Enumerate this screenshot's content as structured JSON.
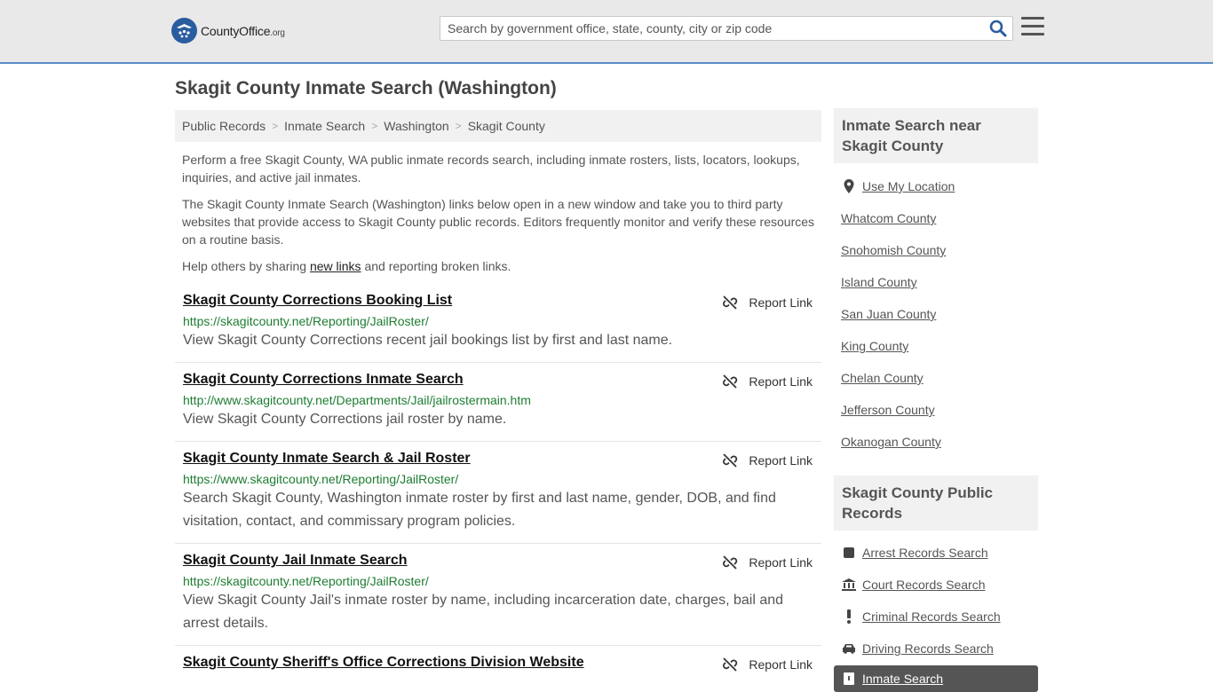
{
  "header": {
    "logo_county": "County",
    "logo_office": "Office",
    "logo_org": ".org",
    "search_placeholder": "Search by government office, state, county, city or zip code"
  },
  "page_title": "Skagit County Inmate Search (Washington)",
  "breadcrumb": [
    "Public Records",
    "Inmate Search",
    "Washington",
    "Skagit County"
  ],
  "intro": {
    "p1": "Perform a free Skagit County, WA public inmate records search, including inmate rosters, lists, locators, lookups, inquiries, and active jail inmates.",
    "p2": "The Skagit County Inmate Search (Washington) links below open in a new window and take you to third party websites that provide access to Skagit County public records. Editors frequently monitor and verify these resources on a routine basis.",
    "p3_before": "Help others by sharing ",
    "p3_link": "new links",
    "p3_after": " and reporting broken links."
  },
  "report_label": "Report Link",
  "results": [
    {
      "title": "Skagit County Corrections Booking List",
      "url": "https://skagitcounty.net/Reporting/JailRoster/",
      "desc": "View Skagit County Corrections recent jail bookings list by first and last name."
    },
    {
      "title": "Skagit County Corrections Inmate Search",
      "url": "http://www.skagitcounty.net/Departments/Jail/jailrostermain.htm",
      "desc": "View Skagit County Corrections jail roster by name."
    },
    {
      "title": "Skagit County Inmate Search & Jail Roster",
      "url": "https://www.skagitcounty.net/Reporting/JailRoster/",
      "desc": "Search Skagit County, Washington inmate roster by first and last name, gender, DOB, and find visitation, contact, and commissary program policies."
    },
    {
      "title": "Skagit County Jail Inmate Search",
      "url": "https://skagitcounty.net/Reporting/JailRoster/",
      "desc": "View Skagit County Jail's inmate roster by name, including incarceration date, charges, bail and arrest details."
    },
    {
      "title": "Skagit County Sheriff's Office Corrections Division Website",
      "url": "",
      "desc": ""
    }
  ],
  "sidebar": {
    "nearby_title": "Inmate Search near Skagit County",
    "nearby": [
      {
        "label": "Use My Location",
        "icon": "location-pin-icon"
      },
      {
        "label": "Whatcom County"
      },
      {
        "label": "Snohomish County"
      },
      {
        "label": "Island County"
      },
      {
        "label": "San Juan County"
      },
      {
        "label": "King County"
      },
      {
        "label": "Chelan County"
      },
      {
        "label": "Jefferson County"
      },
      {
        "label": "Okanogan County"
      }
    ],
    "records_title": "Skagit County Public Records",
    "records": [
      {
        "label": "Arrest Records Search",
        "icon": "square-icon"
      },
      {
        "label": "Court Records Search",
        "icon": "courthouse-icon"
      },
      {
        "label": "Criminal Records Search",
        "icon": "exclamation-icon"
      },
      {
        "label": "Driving Records Search",
        "icon": "car-icon"
      }
    ],
    "active": {
      "label": "Inmate Search",
      "icon": "inmate-icon"
    }
  },
  "colors": {
    "accent_blue": "#2a5d9f",
    "url_green": "#1e7d32",
    "header_border": "#5a8cc4"
  }
}
